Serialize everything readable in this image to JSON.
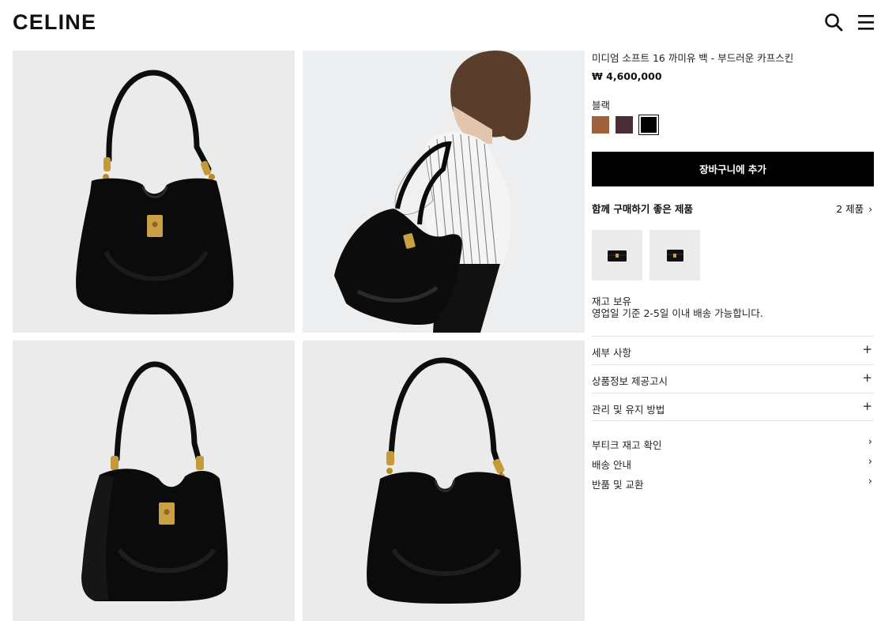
{
  "header": {
    "logo": "CELINE",
    "search_icon": "search-icon",
    "menu_icon": "hamburger-menu-icon"
  },
  "gallery": {
    "images": [
      {
        "name": "bag-front-view"
      },
      {
        "name": "bag-worn-by-model"
      },
      {
        "name": "bag-three-quarter-view"
      },
      {
        "name": "bag-back-view"
      }
    ]
  },
  "product": {
    "name": "미디엄 소프트 16 까미유 백 - 부드러운 카프스킨",
    "price": "₩ 4,600,000",
    "color_label": "블랙",
    "swatches": [
      {
        "name": "tan",
        "color": "#a0603e"
      },
      {
        "name": "burgundy",
        "color": "#4a2e35"
      },
      {
        "name": "black",
        "color": "#000000",
        "selected": true
      }
    ],
    "add_to_cart": "장바구니에 추가"
  },
  "related": {
    "title": "함께 구매하기 좋은 제품",
    "count": "2 제품",
    "chevron": "›"
  },
  "stock": {
    "status": "재고 보유",
    "shipping": "영업일 기준 2-5일 이내 배송 가능합니다."
  },
  "accordion": [
    {
      "label": "세부 사항",
      "icon": "+"
    },
    {
      "label": "상품정보 제공고시",
      "icon": "+"
    },
    {
      "label": "관리 및 유지 방법",
      "icon": "+"
    }
  ],
  "links": [
    {
      "label": "부티크 재고 확인",
      "icon": "›"
    },
    {
      "label": "배송 안내",
      "icon": "›"
    },
    {
      "label": "반품 및 교환",
      "icon": "›"
    }
  ],
  "colors": {
    "gallery_bg": "#ebebec",
    "button_bg": "#000000",
    "button_text": "#ffffff"
  }
}
